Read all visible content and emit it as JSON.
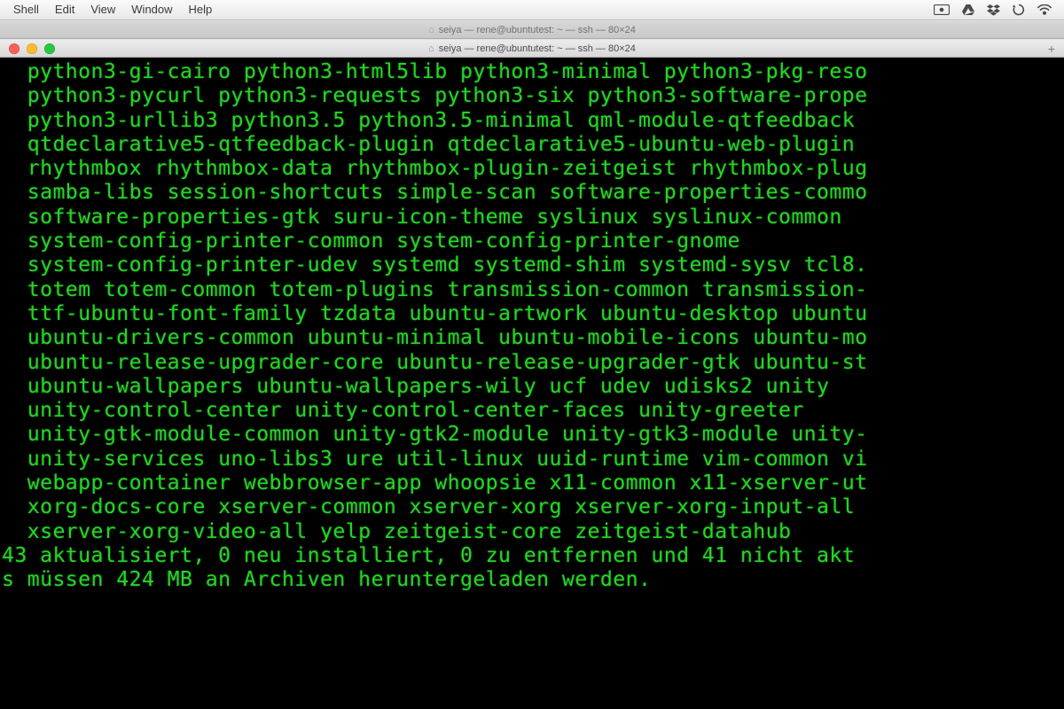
{
  "menubar": {
    "items": [
      "Shell",
      "Edit",
      "View",
      "Window",
      "Help"
    ]
  },
  "tabs": {
    "inactive_label": "seiya — rene@ubuntutest: ~ — ssh — 80×24",
    "active_label": "seiya — rene@ubuntutest: ~ — ssh — 80×24",
    "plus": "+"
  },
  "terminal": {
    "lines": [
      "  python3-gi-cairo python3-html5lib python3-minimal python3-pkg-reso",
      "  python3-pycurl python3-requests python3-six python3-software-prope",
      "  python3-urllib3 python3.5 python3.5-minimal qml-module-qtfeedback",
      "  qtdeclarative5-qtfeedback-plugin qtdeclarative5-ubuntu-web-plugin",
      "  rhythmbox rhythmbox-data rhythmbox-plugin-zeitgeist rhythmbox-plug",
      "  samba-libs session-shortcuts simple-scan software-properties-commo",
      "  software-properties-gtk suru-icon-theme syslinux syslinux-common",
      "  system-config-printer-common system-config-printer-gnome",
      "  system-config-printer-udev systemd systemd-shim systemd-sysv tcl8.",
      "  totem totem-common totem-plugins transmission-common transmission-",
      "  ttf-ubuntu-font-family tzdata ubuntu-artwork ubuntu-desktop ubuntu",
      "  ubuntu-drivers-common ubuntu-minimal ubuntu-mobile-icons ubuntu-mo",
      "  ubuntu-release-upgrader-core ubuntu-release-upgrader-gtk ubuntu-st",
      "  ubuntu-wallpapers ubuntu-wallpapers-wily ucf udev udisks2 unity",
      "  unity-control-center unity-control-center-faces unity-greeter",
      "  unity-gtk-module-common unity-gtk2-module unity-gtk3-module unity-",
      "  unity-services uno-libs3 ure util-linux uuid-runtime vim-common vi",
      "  webapp-container webbrowser-app whoopsie x11-common x11-xserver-ut",
      "  xorg-docs-core xserver-common xserver-xorg xserver-xorg-input-all",
      "  xserver-xorg-video-all yelp zeitgeist-core zeitgeist-datahub",
      "43 aktualisiert, 0 neu installiert, 0 zu entfernen und 41 nicht akt",
      "s müssen 424 MB an Archiven heruntergeladen werden."
    ]
  },
  "icons": {
    "screen": "screen-share-icon",
    "drive": "google-drive-icon",
    "dropbox": "dropbox-icon",
    "sync": "sync-icon",
    "wifi": "wifi-icon"
  }
}
